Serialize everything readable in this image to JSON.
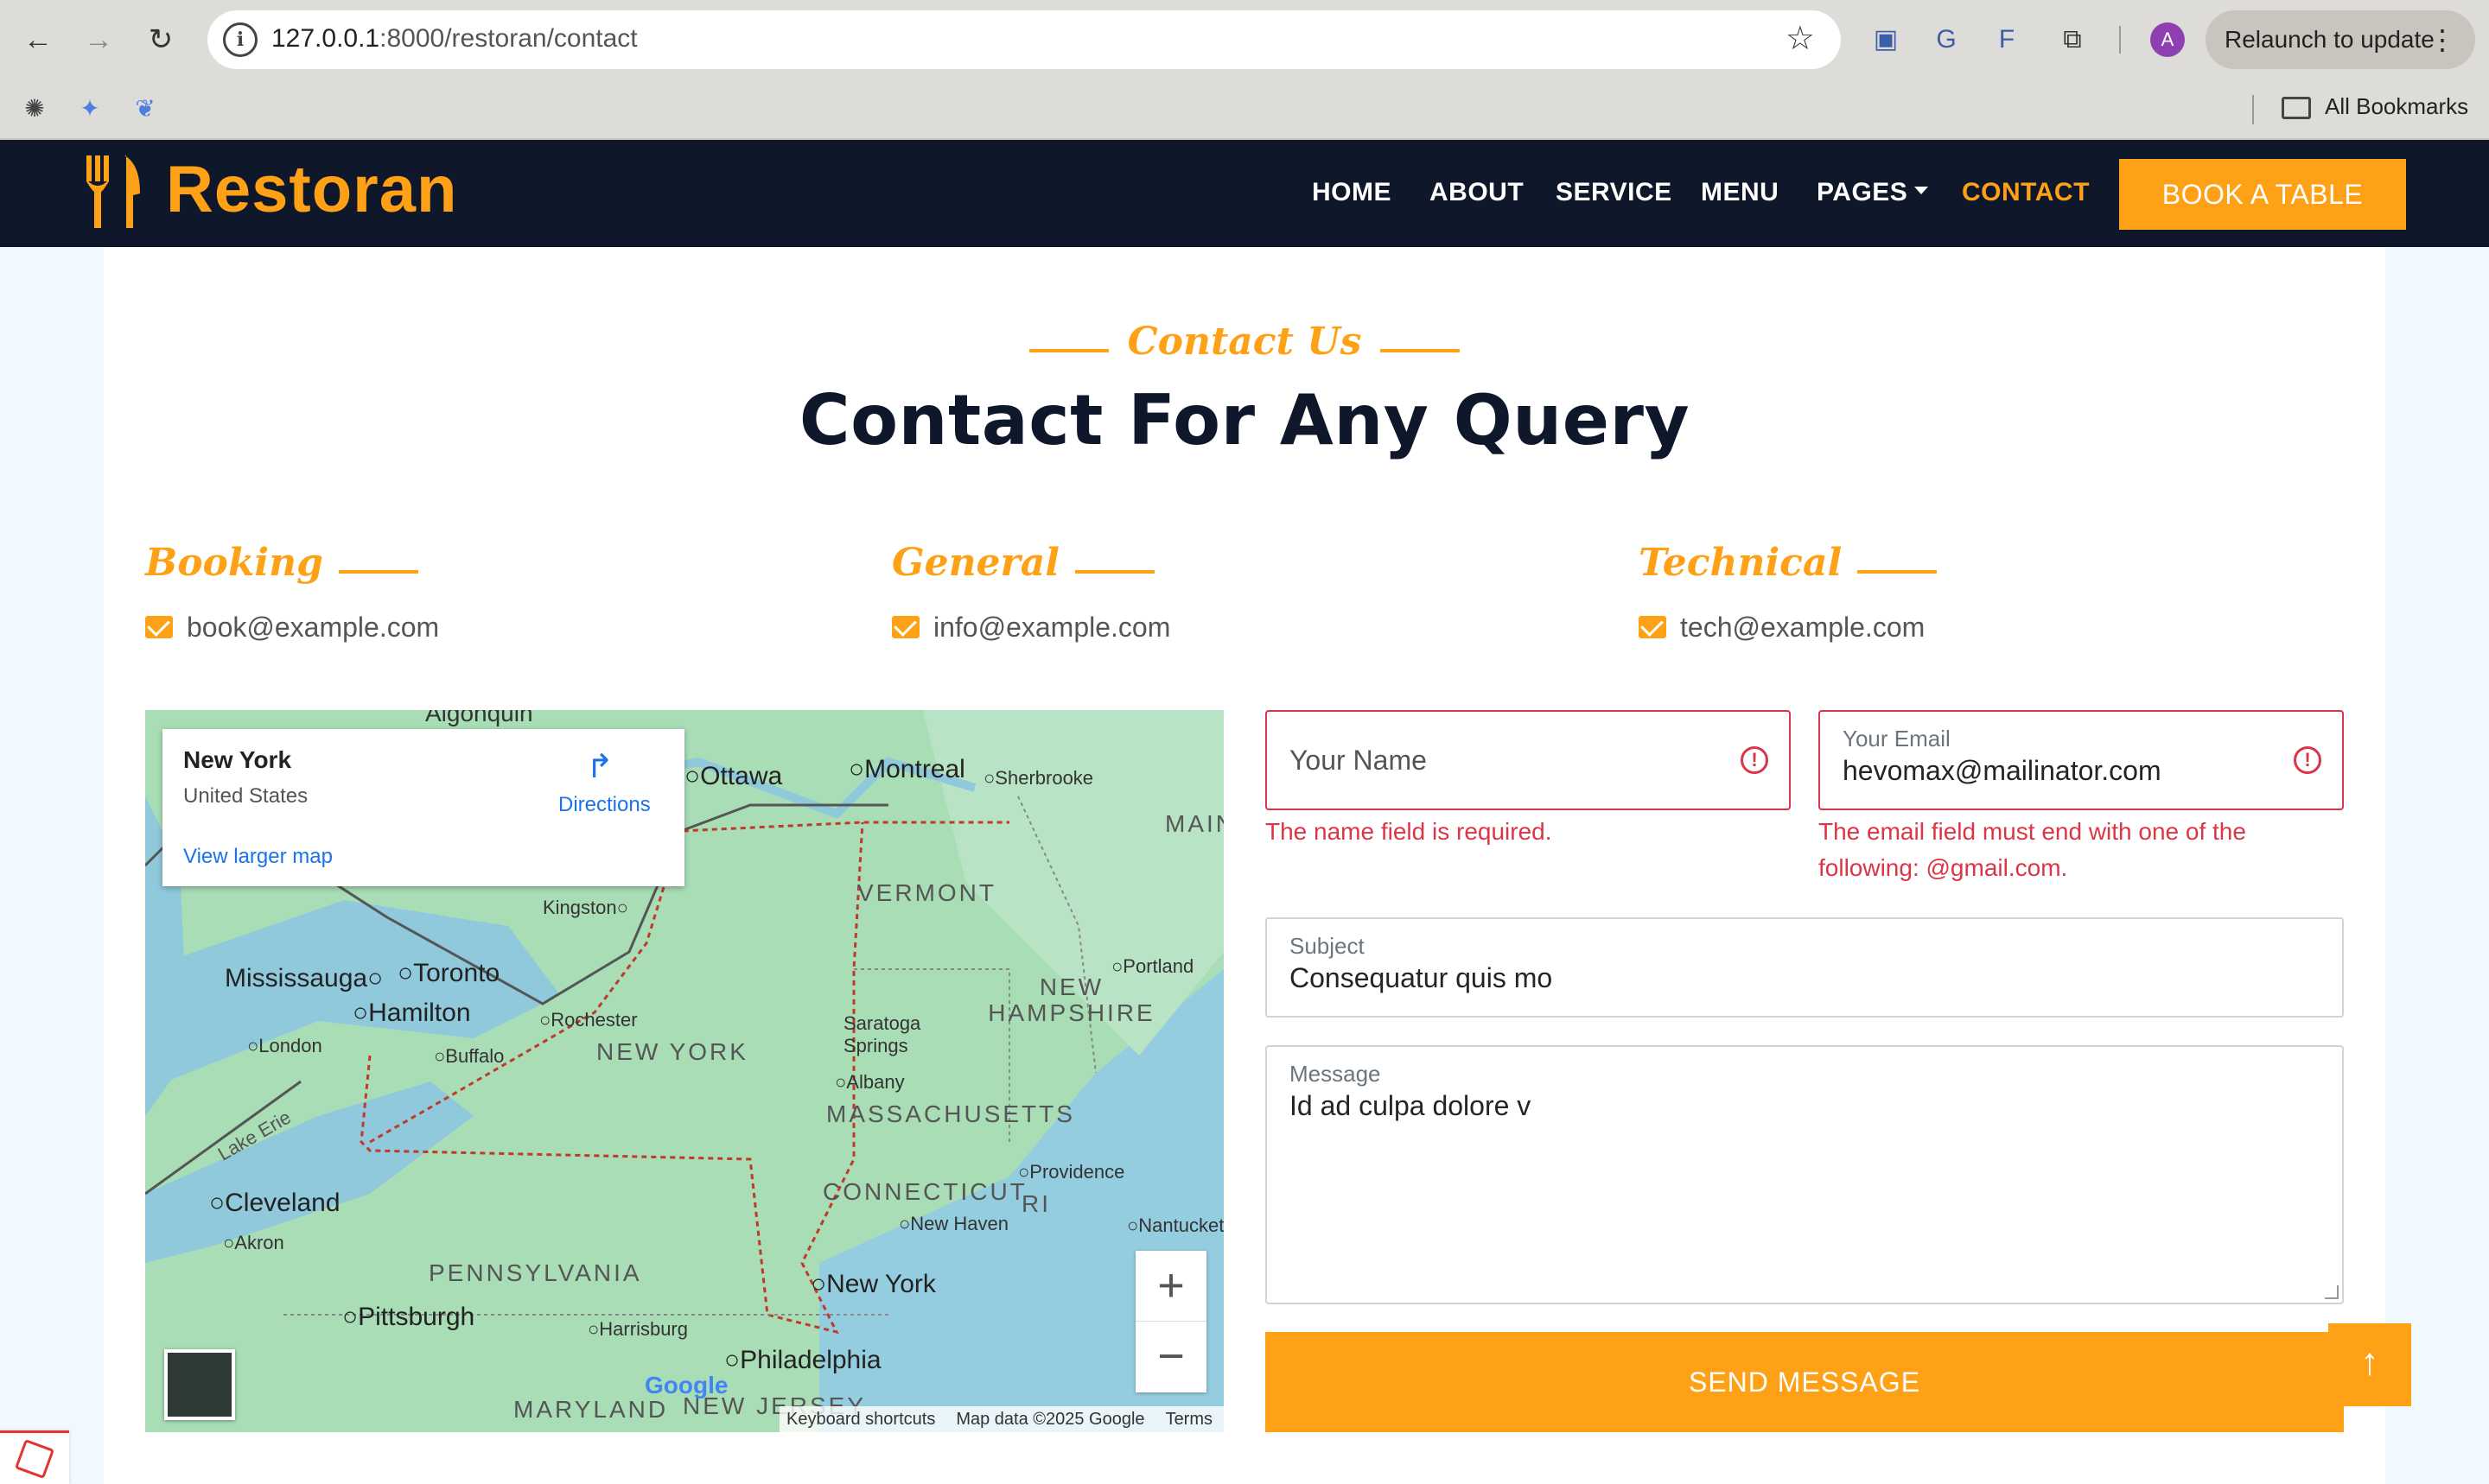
{
  "browser": {
    "url_host": "127.0.0.1",
    "url_path": ":8000/restoran/contact",
    "relaunch_label": "Relaunch to update",
    "avatar_letter": "A",
    "bookmarks_label": "All Bookmarks"
  },
  "navbar": {
    "brand": "Restoran",
    "links": [
      "HOME",
      "ABOUT",
      "SERVICE",
      "MENU",
      "PAGES",
      "CONTACT"
    ],
    "active": "CONTACT",
    "book_button": "BOOK A TABLE",
    "brand_color": "#FEA116",
    "bg_color": "#0F172B"
  },
  "section": {
    "subtitle": "Contact Us",
    "title": "Contact For Any Query"
  },
  "contacts": [
    {
      "heading": "Booking",
      "email": "book@example.com"
    },
    {
      "heading": "General",
      "email": "info@example.com"
    },
    {
      "heading": "Technical",
      "email": "tech@example.com"
    }
  ],
  "map": {
    "card_place": "New York",
    "card_country": "United States",
    "card_larger": "View larger map",
    "card_directions": "Directions",
    "cities": [
      "Algonquin",
      "Ottawa",
      "Montreal",
      "Sherbrooke",
      "Kingston",
      "Mississauga",
      "Toronto",
      "Hamilton",
      "Rochester",
      "London",
      "Buffalo",
      "Saratoga Springs",
      "Albany",
      "Portland",
      "Cleveland",
      "Akron",
      "Providence",
      "New Haven",
      "Nantucket",
      "New York",
      "Pittsburgh",
      "Harrisburg",
      "Philadelphia",
      "Lake Erie"
    ],
    "states": [
      "VERMONT",
      "MAIN",
      "NEW HAMPSHIRE",
      "NEW YORK",
      "MASSACHUSETTS",
      "CONNECTICUT",
      "RI",
      "PENNSYLVANIA",
      "MARYLAND",
      "NEW JERSEY"
    ],
    "google": "Google",
    "attribution": [
      "Keyboard shortcuts",
      "Map data ©2025 Google",
      "Terms"
    ]
  },
  "form": {
    "name_placeholder": "Your Name",
    "name_error": "The name field is required.",
    "email_label": "Your Email",
    "email_value": "hevomax@mailinator.com",
    "email_error_1": "The email field must end with one of the",
    "email_error_2": "following: @gmail.com.",
    "subject_label": "Subject",
    "subject_value": "Consequatur quis mo",
    "message_label": "Message",
    "message_value": "Id ad culpa dolore v",
    "send_button": "SEND MESSAGE",
    "error_color": "#DC3545"
  },
  "icons": {
    "back_to_top": "arrow-up-icon",
    "email": "envelope-open-icon"
  }
}
